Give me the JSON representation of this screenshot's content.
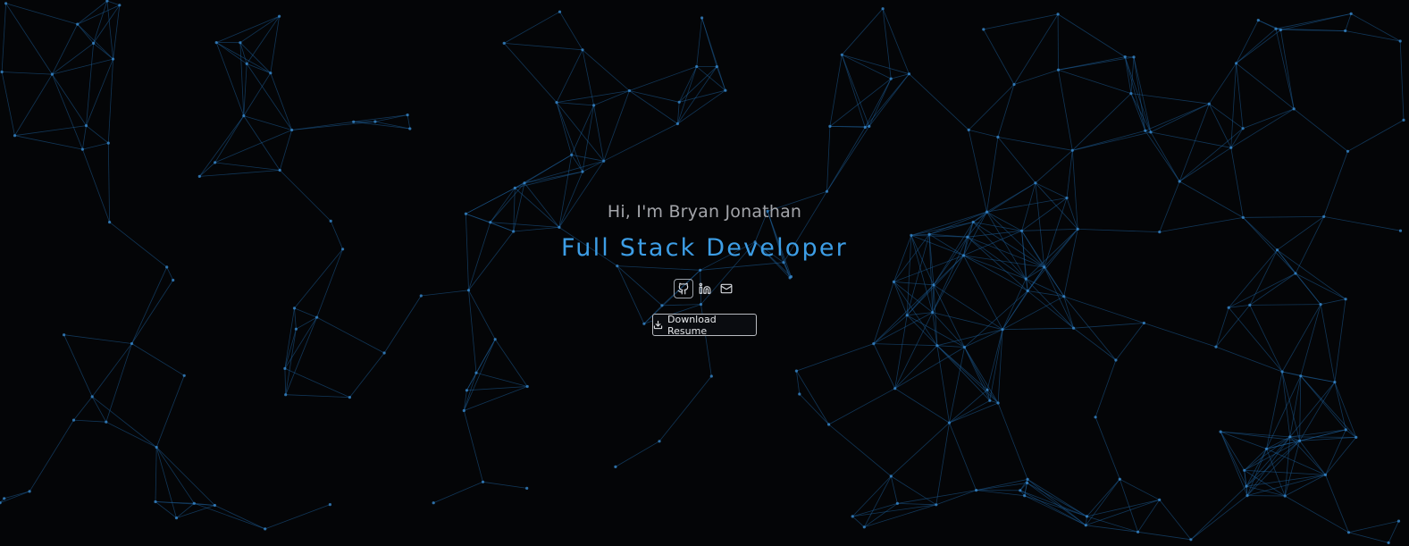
{
  "hero": {
    "greeting": "Hi, I'm Bryan Jonathan",
    "role": "Full Stack Developer",
    "socials": [
      {
        "name": "GitHub",
        "icon": "github-icon"
      },
      {
        "name": "LinkedIn",
        "icon": "linkedin-icon"
      },
      {
        "name": "Email",
        "icon": "mail-icon"
      }
    ],
    "resume_button": {
      "label": "Download Resume",
      "icon": "download-icon"
    }
  },
  "theme": {
    "background": "#040507",
    "accent": "#3d9ee6",
    "network_line": "#1d5f99",
    "network_node": "#3b8fd6",
    "greeting_text": "#a3a5aa"
  }
}
